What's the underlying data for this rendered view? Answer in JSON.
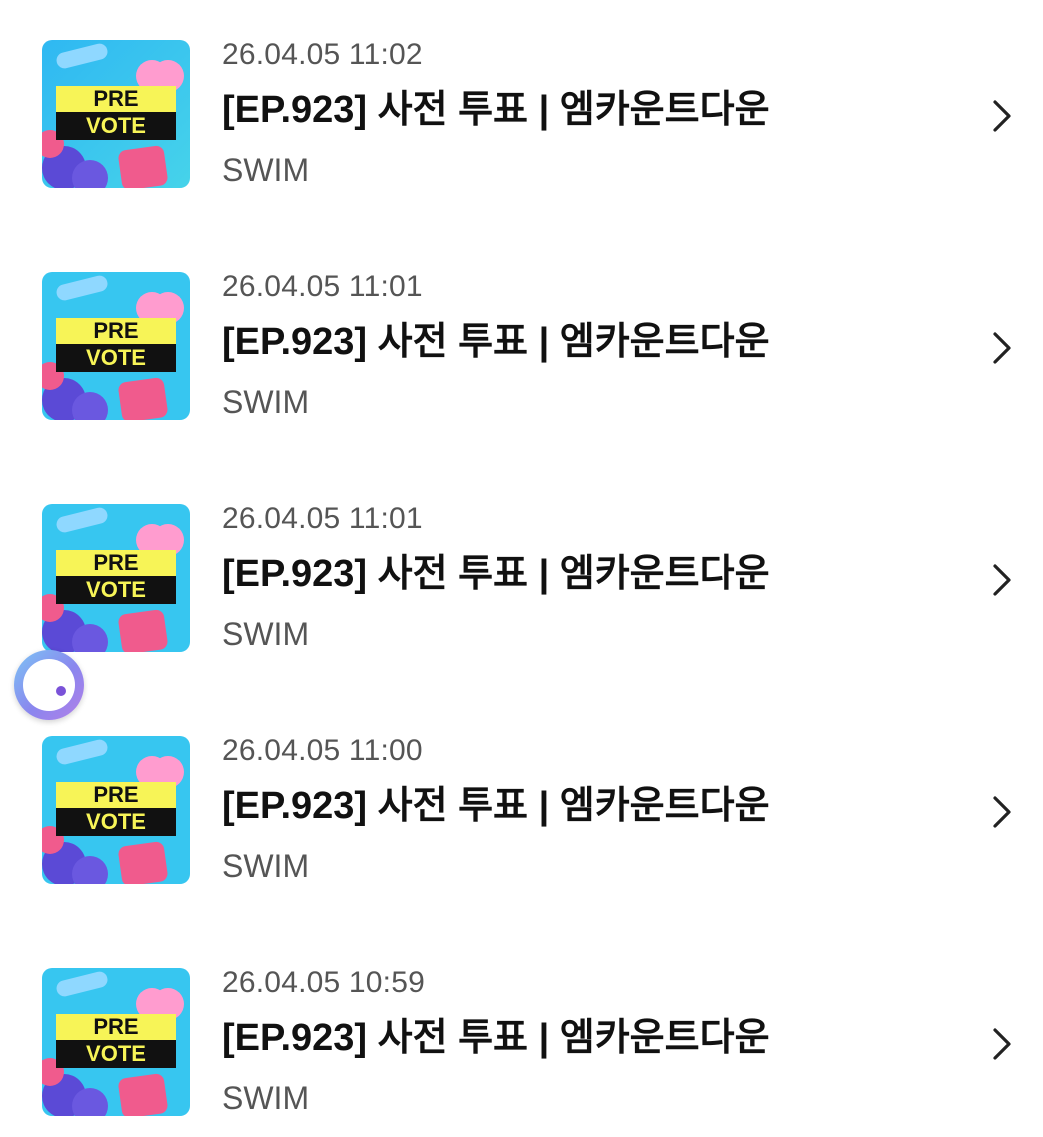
{
  "items": [
    {
      "date": "26.04.05 11:02",
      "title": "[EP.923] 사전 투표 | 엠카운트다운",
      "artist": "SWIM",
      "thumb_text": [
        "PRE",
        "VOTE"
      ]
    },
    {
      "date": "26.04.05 11:01",
      "title": "[EP.923] 사전 투표 | 엠카운트다운",
      "artist": "SWIM",
      "thumb_text": [
        "PRE",
        "VOTE"
      ]
    },
    {
      "date": "26.04.05 11:01",
      "title": "[EP.923] 사전 투표 | 엠카운트다운",
      "artist": "SWIM",
      "thumb_text": [
        "PRE",
        "VOTE"
      ]
    },
    {
      "date": "26.04.05 11:00",
      "title": "[EP.923] 사전 투표 | 엠카운트다운",
      "artist": "SWIM",
      "thumb_text": [
        "PRE",
        "VOTE"
      ]
    },
    {
      "date": "26.04.05 10:59",
      "title": "[EP.923] 사전 투표 | 엠카운트다운",
      "artist": "SWIM",
      "thumb_text": [
        "PRE",
        "VOTE"
      ]
    }
  ],
  "icons": {
    "thumbnail": "pre-vote-thumbnail-icon",
    "row_action": "chevron-right-icon",
    "floating": "floating-assistant-icon"
  },
  "colors": {
    "date_text": "#555555",
    "title_text": "#111111",
    "chevron": "#222222",
    "thumb_bg": "#37c6f0",
    "thumb_banner_yellow": "#f7f457",
    "thumb_banner_black": "#111111",
    "thumb_pink": "#f05b8d",
    "thumb_purple": "#5b4ad6"
  }
}
